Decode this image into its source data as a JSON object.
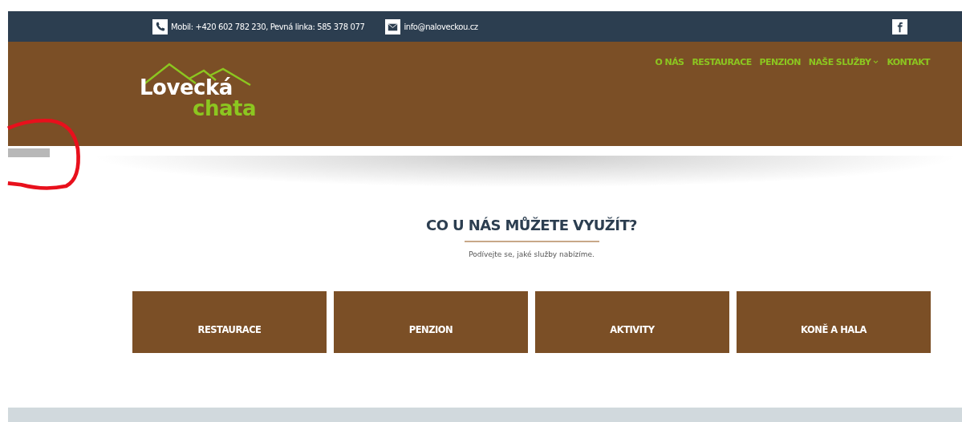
{
  "top_bar": {
    "phone": "Mobil: +420 602 782 230, Pevná linka: 585 378 077",
    "email": "info@naloveckou.cz"
  },
  "logo": {
    "line_1": "Lovecká",
    "line_2": "chata"
  },
  "nav": [
    {
      "label": "O NÁS",
      "dropdown": false
    },
    {
      "label": "RESTAURACE",
      "dropdown": false
    },
    {
      "label": "PENZION",
      "dropdown": false
    },
    {
      "label": "NAŠE SLUŽBY",
      "dropdown": true
    },
    {
      "label": "KONTAKT",
      "dropdown": false
    }
  ],
  "section": {
    "title": "CO U NÁS MŮŽETE VYUŽÍT?",
    "subtitle": "Podívejte se, jaké služby nabízíme."
  },
  "cards": [
    {
      "label": "RESTAURACE"
    },
    {
      "label": "PENZION"
    },
    {
      "label": "AKTIVITY"
    },
    {
      "label": "KONĚ A HALA"
    }
  ]
}
